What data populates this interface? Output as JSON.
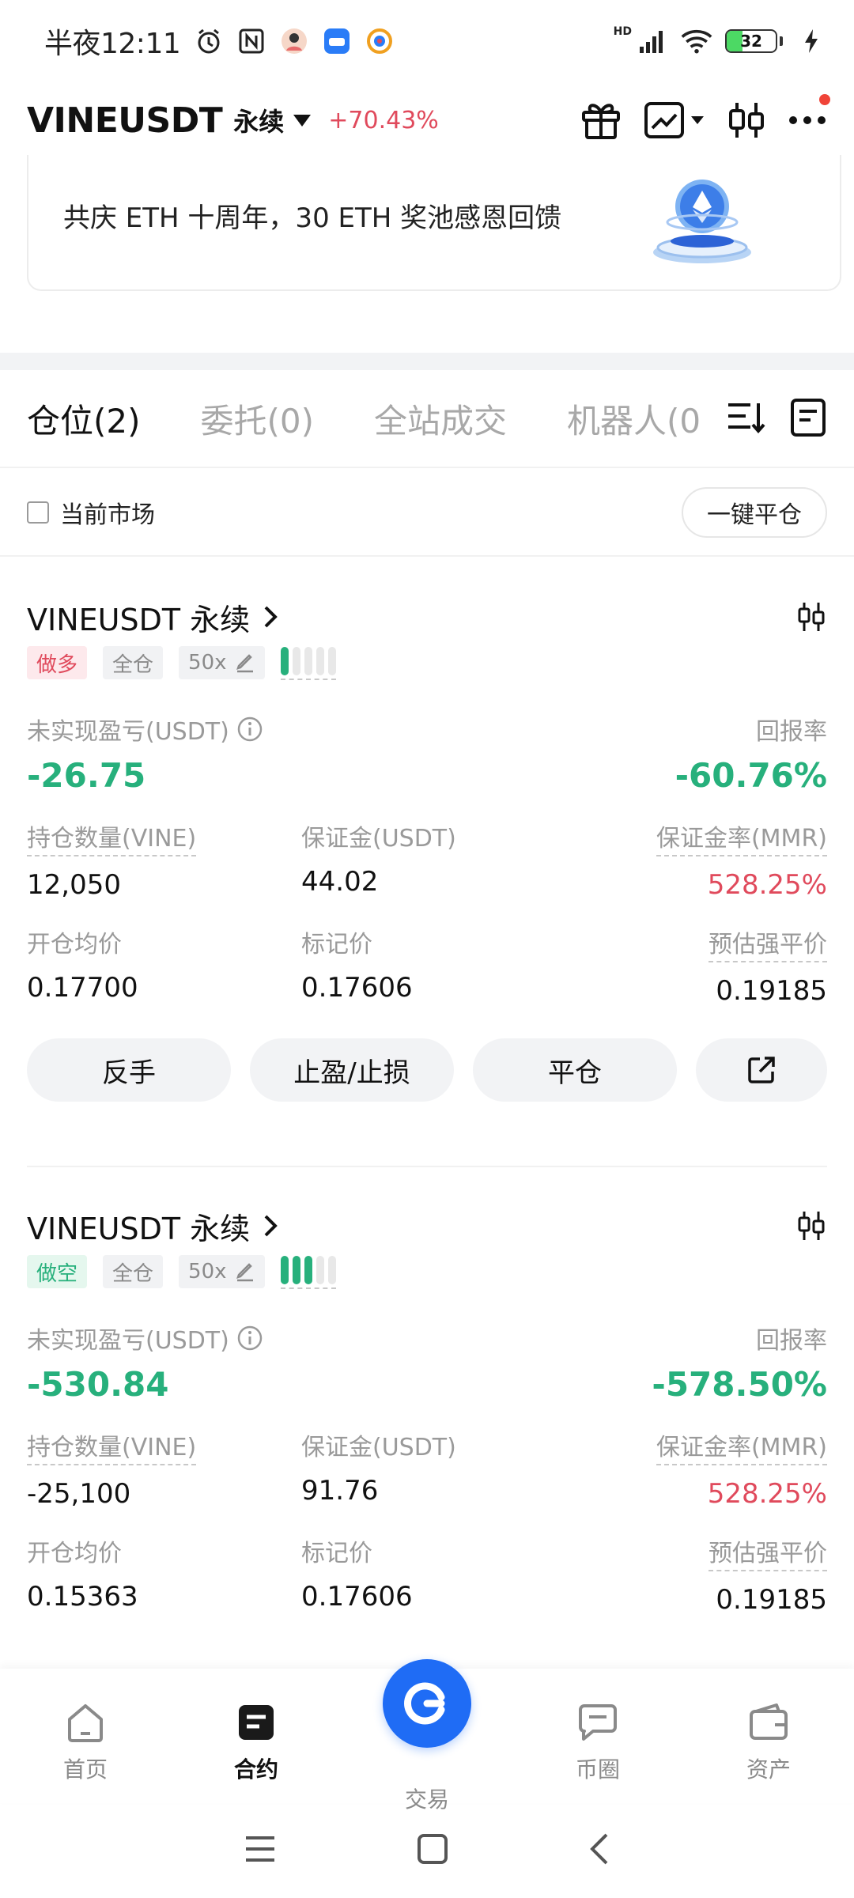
{
  "status_bar": {
    "time": "半夜12:11",
    "network": "HD",
    "battery": "32",
    "battery_level": 0.32
  },
  "header": {
    "symbol": "VINEUSDT",
    "contract_type": "永续",
    "change": "+70.43%",
    "icons": [
      "gift-icon",
      "chart-icon",
      "candlestick-icon",
      "more-icon"
    ]
  },
  "banner": {
    "text": "共庆 ETH 十周年，30 ETH 奖池感恩回馈"
  },
  "tabs": [
    {
      "label": "仓位(2)",
      "active": true
    },
    {
      "label": "委托(0)",
      "active": false
    },
    {
      "label": "全站成交",
      "active": false
    },
    {
      "label": "机器人(0",
      "active": false
    }
  ],
  "filter": {
    "current_market_label": "当前市场",
    "close_all_label": "一键平仓"
  },
  "positions": [
    {
      "title": "VINEUSDT 永续",
      "side": "做多",
      "margin_mode": "全仓",
      "leverage": "50x",
      "risk_level": 1,
      "pnl_label": "未实现盈亏(USDT)",
      "roe_label": "回报率",
      "pnl": "-26.75",
      "roe": "-60.76%",
      "size_label": "持仓数量(VINE)",
      "margin_label": "保证金(USDT)",
      "mmr_label": "保证金率(MMR)",
      "size": "12,050",
      "margin": "44.02",
      "mmr": "528.25%",
      "entry_label": "开仓均价",
      "mark_label": "标记价",
      "liq_label": "预估强平价",
      "entry": "0.17700",
      "mark": "0.17606",
      "liq": "0.19185",
      "actions": {
        "reverse": "反手",
        "tpsl": "止盈/止损",
        "close": "平仓"
      }
    },
    {
      "title": "VINEUSDT 永续",
      "side": "做空",
      "margin_mode": "全仓",
      "leverage": "50x",
      "risk_level": 3,
      "pnl_label": "未实现盈亏(USDT)",
      "roe_label": "回报率",
      "pnl": "-530.84",
      "roe": "-578.50%",
      "size_label": "持仓数量(VINE)",
      "margin_label": "保证金(USDT)",
      "mmr_label": "保证金率(MMR)",
      "size": "-25,100",
      "margin": "91.76",
      "mmr": "528.25%",
      "entry_label": "开仓均价",
      "mark_label": "标记价",
      "liq_label": "预估强平价",
      "entry": "0.15363",
      "mark": "0.17606",
      "liq": "0.19185"
    }
  ],
  "bottom_nav": [
    {
      "label": "首页",
      "icon": "home-icon"
    },
    {
      "label": "合约",
      "icon": "contract-icon",
      "active": true
    },
    {
      "label": "交易",
      "icon": "trade-icon"
    },
    {
      "label": "币圈",
      "icon": "community-icon"
    },
    {
      "label": "资产",
      "icon": "wallet-icon"
    }
  ],
  "colors": {
    "up_green": "#27b07c",
    "down_red": "#e04a5c",
    "brand_blue": "#1f6cf5"
  }
}
